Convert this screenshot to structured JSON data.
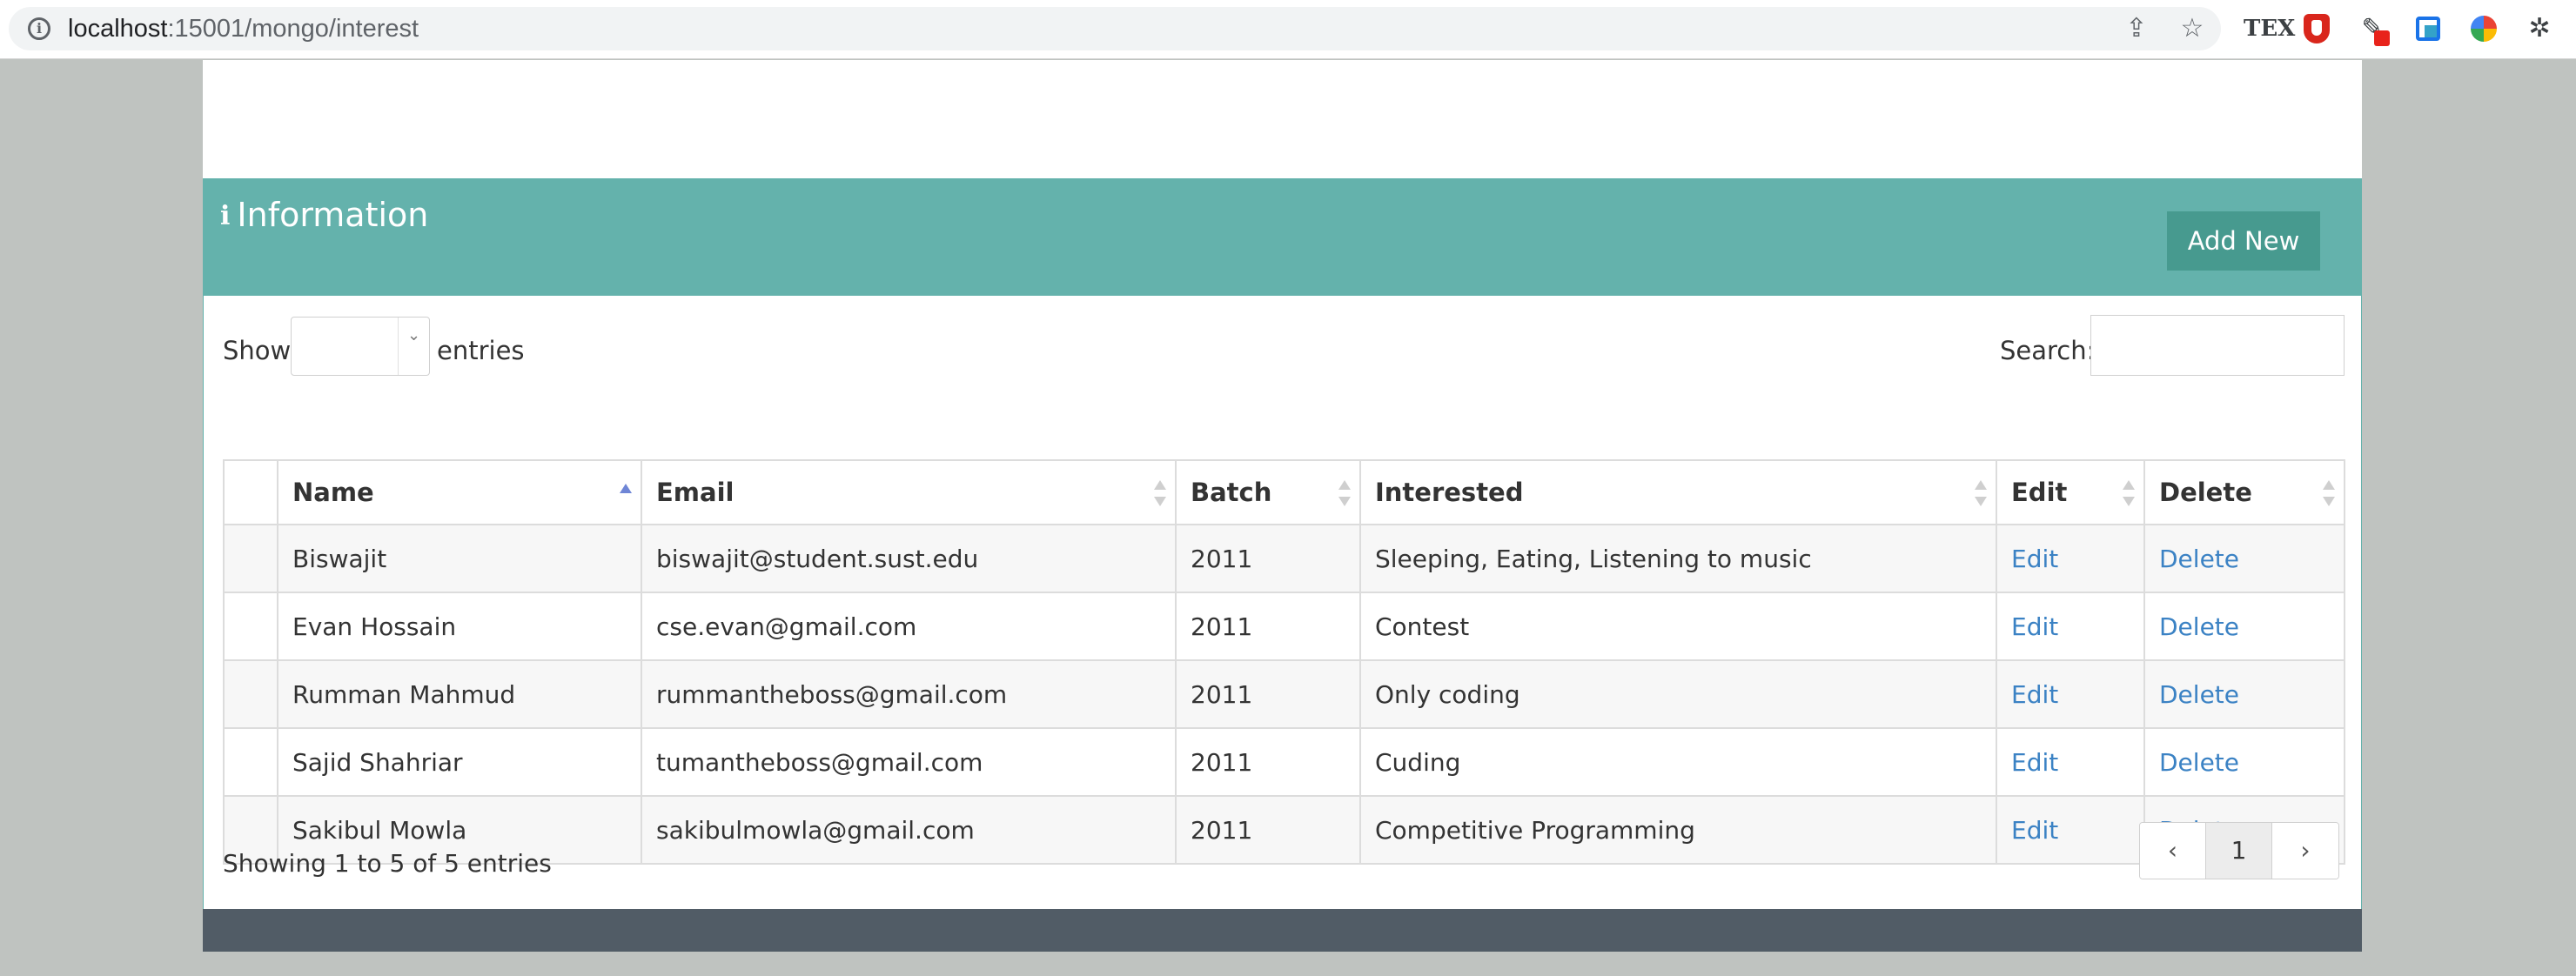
{
  "browser": {
    "url_host": "localhost",
    "url_path": ":15001/mongo/interest",
    "icons": [
      "info-icon",
      "share-icon",
      "star-icon",
      "tex-extension-icon",
      "shield-extension-icon",
      "eyedropper-extension-icon",
      "copy-extension-icon",
      "color-wheel-extension-icon",
      "puzzle-extensions-icon"
    ]
  },
  "panel": {
    "title_icon": "i",
    "title": "Information",
    "add_button": "Add New"
  },
  "controls": {
    "show_label": "Show",
    "entries_label": "entries",
    "search_label": "Search:",
    "search_value": "",
    "length_value": ""
  },
  "table": {
    "columns": [
      "",
      "Name",
      "Email",
      "Batch",
      "Interested",
      "Edit",
      "Delete"
    ],
    "sorted_column": "Name",
    "sort_direction": "ascending",
    "rows": [
      {
        "name": "Biswajit",
        "email": "biswajit@student.sust.edu",
        "batch": "2011",
        "interested": "Sleeping, Eating, Listening to music",
        "edit": "Edit",
        "delete": "Delete"
      },
      {
        "name": "Evan Hossain",
        "email": "cse.evan@gmail.com",
        "batch": "2011",
        "interested": "Contest",
        "edit": "Edit",
        "delete": "Delete"
      },
      {
        "name": "Rumman Mahmud",
        "email": "rummantheboss@gmail.com",
        "batch": "2011",
        "interested": "Only coding",
        "edit": "Edit",
        "delete": "Delete"
      },
      {
        "name": "Sajid Shahriar",
        "email": "tumantheboss@gmail.com",
        "batch": "2011",
        "interested": "Cuding",
        "edit": "Edit",
        "delete": "Delete"
      },
      {
        "name": "Sakibul Mowla",
        "email": "sakibulmowla@gmail.com",
        "batch": "2011",
        "interested": "Competitive Programming",
        "edit": "Edit",
        "delete": "Delete"
      }
    ]
  },
  "footer": {
    "info": "Showing 1 to 5 of 5 entries",
    "prev": "‹",
    "page": "1",
    "next": "›"
  },
  "colors": {
    "panel_header": "#64b2ac",
    "add_button": "#479a8f",
    "link": "#3b82c4",
    "footer_bar": "#515c66"
  }
}
